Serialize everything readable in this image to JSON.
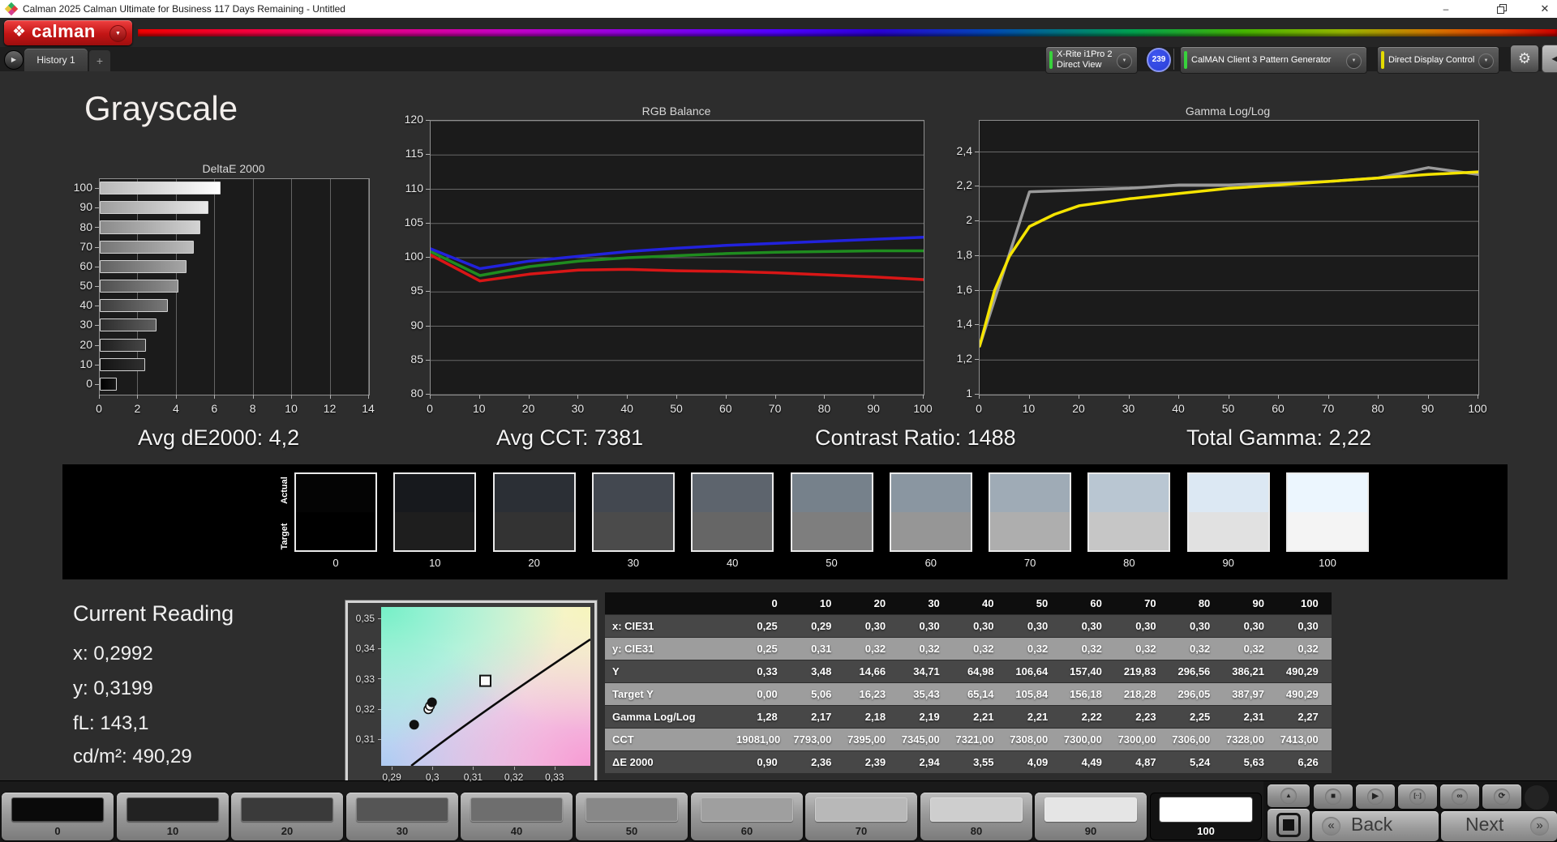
{
  "window": {
    "title": "Calman 2025 Calman Ultimate for Business 117 Days Remaining  - Untitled",
    "controls": {
      "minimize": "–",
      "close": "✕"
    }
  },
  "brand": {
    "logo_text": "calman"
  },
  "colors": {
    "vars": {
      "accent-green": "#38d23c",
      "accent-yellow": "#e4dc00",
      "badge-blue": "#2b3fd6",
      "logo-red": "#c61d1d"
    },
    "app_icon": [
      "#2fae5f",
      "#e0393f",
      "#d6408f",
      "#e8c63a"
    ]
  },
  "icons": {
    "logo": "❖",
    "dropdown_arrow": "▼",
    "tab_scroll": "▶",
    "gear": "⚙",
    "collapse": "◀",
    "up": "▲",
    "back_chev": "«",
    "next_chev": "»"
  },
  "toolbar": {
    "history_tab": "History 1",
    "add_tab": "+",
    "meter_device": {
      "line1": "X-Rite i1Pro 2",
      "line2": "Direct View"
    },
    "meter_badge": "239",
    "pattern_generator": "CalMAN Client 3 Pattern Generator",
    "display_control": "Direct Display Control"
  },
  "page": {
    "title": "Grayscale"
  },
  "stats": [
    {
      "label": "Avg dE2000: 4,2"
    },
    {
      "label": "Avg CCT: 7381"
    },
    {
      "label": "Contrast Ratio: 1488"
    },
    {
      "label": "Total Gamma: 2,22"
    }
  ],
  "chart_data": [
    {
      "id": "deltae",
      "type": "bar",
      "orientation": "horizontal",
      "title": "DeltaE 2000",
      "categories": [
        100,
        90,
        80,
        70,
        60,
        50,
        40,
        30,
        20,
        10,
        0
      ],
      "values": [
        6.26,
        5.63,
        5.24,
        4.87,
        4.49,
        4.09,
        3.55,
        2.94,
        2.39,
        2.36,
        0.9
      ],
      "xlim": [
        0,
        14
      ],
      "xticks": [
        0,
        2,
        4,
        6,
        8,
        10,
        12,
        14
      ],
      "grid": "vertical",
      "bar_colors": [
        [
          "#b8b8b8",
          "#ffffff"
        ],
        [
          "#9e9e9e",
          "#e9e9e9"
        ],
        [
          "#8a8a8a",
          "#d3d3d3"
        ],
        [
          "#757575",
          "#bdbdbd"
        ],
        [
          "#616161",
          "#a6a6a6"
        ],
        [
          "#4f4f4f",
          "#909090"
        ],
        [
          "#3d3d3d",
          "#787878"
        ],
        [
          "#2d2d2d",
          "#5f5f5f"
        ],
        [
          "#1f1f1f",
          "#464646"
        ],
        [
          "#141414",
          "#2f2f2f"
        ],
        [
          "#000000",
          "#171717"
        ]
      ]
    },
    {
      "id": "rgb",
      "type": "line",
      "title": "RGB Balance",
      "ylim": [
        80,
        120
      ],
      "yticks": {
        "values": [
          120,
          115,
          110,
          105,
          100,
          95,
          90,
          85,
          80
        ],
        "labels": [
          "120",
          "115",
          "110",
          "105",
          "100",
          "95",
          "90",
          "85",
          "80"
        ]
      },
      "xticks": [
        0,
        10,
        20,
        30,
        40,
        50,
        60,
        70,
        80,
        90,
        100
      ],
      "grid": "horizontal",
      "series": [
        {
          "name": "Red",
          "color": "#d81616",
          "x": [
            0,
            10,
            20,
            30,
            40,
            50,
            60,
            70,
            80,
            90,
            100
          ],
          "values": [
            100.4,
            96.6,
            97.6,
            98.2,
            98.3,
            98.1,
            98.0,
            97.8,
            97.5,
            97.2,
            96.8
          ]
        },
        {
          "name": "Green",
          "color": "#1f8c1f",
          "x": [
            0,
            10,
            20,
            30,
            40,
            50,
            60,
            70,
            80,
            90,
            100
          ],
          "values": [
            100.9,
            97.4,
            98.7,
            99.5,
            100.0,
            100.3,
            100.6,
            100.8,
            100.9,
            101.0,
            101.0
          ]
        },
        {
          "name": "Blue",
          "color": "#2222dd",
          "x": [
            0,
            10,
            20,
            30,
            40,
            50,
            60,
            70,
            80,
            90,
            100
          ],
          "values": [
            101.3,
            98.4,
            99.5,
            100.2,
            100.9,
            101.4,
            101.8,
            102.1,
            102.4,
            102.7,
            103.0
          ]
        }
      ]
    },
    {
      "id": "gamma",
      "type": "line",
      "title": "Gamma Log/Log",
      "ylim": [
        1.0,
        2.58
      ],
      "yticks": {
        "values": [
          2.4,
          2.2,
          2.0,
          1.8,
          1.6,
          1.4,
          1.2,
          1.0
        ],
        "labels": [
          "2,4",
          "2,2",
          "2",
          "1,8",
          "1,6",
          "1,4",
          "1,2",
          "1"
        ]
      },
      "xticks": [
        0,
        10,
        20,
        30,
        40,
        50,
        60,
        70,
        80,
        90,
        100
      ],
      "grid": "horizontal",
      "series": [
        {
          "name": "Measured Gamma",
          "color": "#9a9a9a",
          "x": [
            0,
            10,
            20,
            30,
            40,
            50,
            60,
            70,
            80,
            90,
            100
          ],
          "values": [
            1.28,
            2.17,
            2.18,
            2.19,
            2.21,
            2.21,
            2.22,
            2.23,
            2.25,
            2.31,
            2.27
          ]
        },
        {
          "name": "Target Gamma",
          "color": "#f5e400",
          "x": [
            0,
            3,
            6,
            10,
            15,
            20,
            30,
            40,
            50,
            60,
            70,
            80,
            90,
            100
          ],
          "values": [
            1.28,
            1.6,
            1.8,
            1.97,
            2.04,
            2.09,
            2.13,
            2.16,
            2.19,
            2.21,
            2.23,
            2.25,
            2.27,
            2.285
          ]
        }
      ]
    },
    {
      "id": "cie",
      "type": "scatter",
      "title": "CIE xy",
      "xlim": [
        0.2874,
        0.3388
      ],
      "ylim": [
        0.3012,
        0.3537
      ],
      "xticks": {
        "values": [
          0.29,
          0.3,
          0.31,
          0.32,
          0.33
        ],
        "labels": [
          "0,29",
          "0,3",
          "0,31",
          "0,32",
          "0,33"
        ]
      },
      "yticks": {
        "values": [
          0.35,
          0.34,
          0.33,
          0.32,
          0.31
        ],
        "labels": [
          "0,35",
          "0,34",
          "0,33",
          "0,32",
          "0,31"
        ]
      },
      "locus": [
        [
          0.2948,
          0.3012
        ],
        [
          0.3129,
          0.3192
        ],
        [
          0.3388,
          0.343
        ]
      ],
      "target_marker": {
        "x": 0.313,
        "y": 0.3293
      },
      "points": [
        {
          "x": 0.2955,
          "y": 0.3148,
          "fill": "#111111"
        },
        {
          "x": 0.299,
          "y": 0.3199,
          "fill": "#ffffff"
        },
        {
          "x": 0.2994,
          "y": 0.321,
          "fill": "#ffffff"
        },
        {
          "x": 0.2999,
          "y": 0.3222,
          "fill": "#111111"
        }
      ]
    }
  ],
  "swatch_strip": {
    "row_labels": [
      "Actual",
      "Target"
    ],
    "levels": [
      "0",
      "10",
      "20",
      "30",
      "40",
      "50",
      "60",
      "70",
      "80",
      "90",
      "100"
    ],
    "actual_colors": [
      "#040404",
      "#17191d",
      "#2b2f35",
      "#434850",
      "#5d646d",
      "#76818b",
      "#8a96a1",
      "#9fabb6",
      "#b9c6d2",
      "#dce8f3",
      "#ecf6fe"
    ],
    "target_colors": [
      "#000000",
      "#1e1e1e",
      "#333333",
      "#4b4b4b",
      "#666666",
      "#7e7e7e",
      "#969696",
      "#aeaeae",
      "#c6c6c6",
      "#e1e1e1",
      "#f4f4f4"
    ]
  },
  "current_reading": {
    "title": "Current Reading",
    "lines": [
      "x: 0,2992",
      "y: 0,3199",
      "fL: 143,1",
      "cd/m²: 490,29"
    ]
  },
  "table": {
    "columns": [
      "",
      "0",
      "10",
      "20",
      "30",
      "40",
      "50",
      "60",
      "70",
      "80",
      "90",
      "100"
    ],
    "rows": [
      {
        "label": "x: CIE31",
        "shade": "dark",
        "values": [
          "0,25",
          "0,29",
          "0,30",
          "0,30",
          "0,30",
          "0,30",
          "0,30",
          "0,30",
          "0,30",
          "0,30",
          "0,30"
        ]
      },
      {
        "label": "y: CIE31",
        "shade": "light",
        "values": [
          "0,25",
          "0,31",
          "0,32",
          "0,32",
          "0,32",
          "0,32",
          "0,32",
          "0,32",
          "0,32",
          "0,32",
          "0,32"
        ]
      },
      {
        "label": "Y",
        "shade": "dark",
        "values": [
          "0,33",
          "3,48",
          "14,66",
          "34,71",
          "64,98",
          "106,64",
          "157,40",
          "219,83",
          "296,56",
          "386,21",
          "490,29"
        ]
      },
      {
        "label": "Target Y",
        "shade": "light",
        "values": [
          "0,00",
          "5,06",
          "16,23",
          "35,43",
          "65,14",
          "105,84",
          "156,18",
          "218,28",
          "296,05",
          "387,97",
          "490,29"
        ]
      },
      {
        "label": "Gamma Log/Log",
        "shade": "dark",
        "values": [
          "1,28",
          "2,17",
          "2,18",
          "2,19",
          "2,21",
          "2,21",
          "2,22",
          "2,23",
          "2,25",
          "2,31",
          "2,27"
        ]
      },
      {
        "label": "CCT",
        "shade": "light",
        "values": [
          "19081,00",
          "7793,00",
          "7395,00",
          "7345,00",
          "7321,00",
          "7308,00",
          "7300,00",
          "7300,00",
          "7306,00",
          "7328,00",
          "7413,00"
        ]
      },
      {
        "label": "ΔE 2000",
        "shade": "dark",
        "values": [
          "0,90",
          "2,36",
          "2,39",
          "2,94",
          "3,55",
          "4,09",
          "4,49",
          "4,87",
          "5,24",
          "5,63",
          "6,26"
        ]
      }
    ]
  },
  "bottom_bar": {
    "patches": [
      {
        "level": "0",
        "color": "#0a0a0a"
      },
      {
        "level": "10",
        "color": "#222222"
      },
      {
        "level": "20",
        "color": "#3a3a3a"
      },
      {
        "level": "30",
        "color": "#555555"
      },
      {
        "level": "40",
        "color": "#6e6e6e"
      },
      {
        "level": "50",
        "color": "#888888"
      },
      {
        "level": "60",
        "color": "#9f9f9f"
      },
      {
        "level": "70",
        "color": "#b8b8b8"
      },
      {
        "level": "80",
        "color": "#cecece"
      },
      {
        "level": "90",
        "color": "#e5e5e5"
      },
      {
        "level": "100",
        "color": "#ffffff",
        "selected": true
      }
    ],
    "transport": [
      {
        "name": "stop",
        "glyph": "■"
      },
      {
        "name": "play",
        "glyph": "▶"
      },
      {
        "name": "frame-step",
        "glyph": "[··]"
      },
      {
        "name": "continuous",
        "glyph": "∞"
      },
      {
        "name": "refresh",
        "glyph": "⟳"
      }
    ],
    "back_label": "Back",
    "next_label": "Next"
  }
}
